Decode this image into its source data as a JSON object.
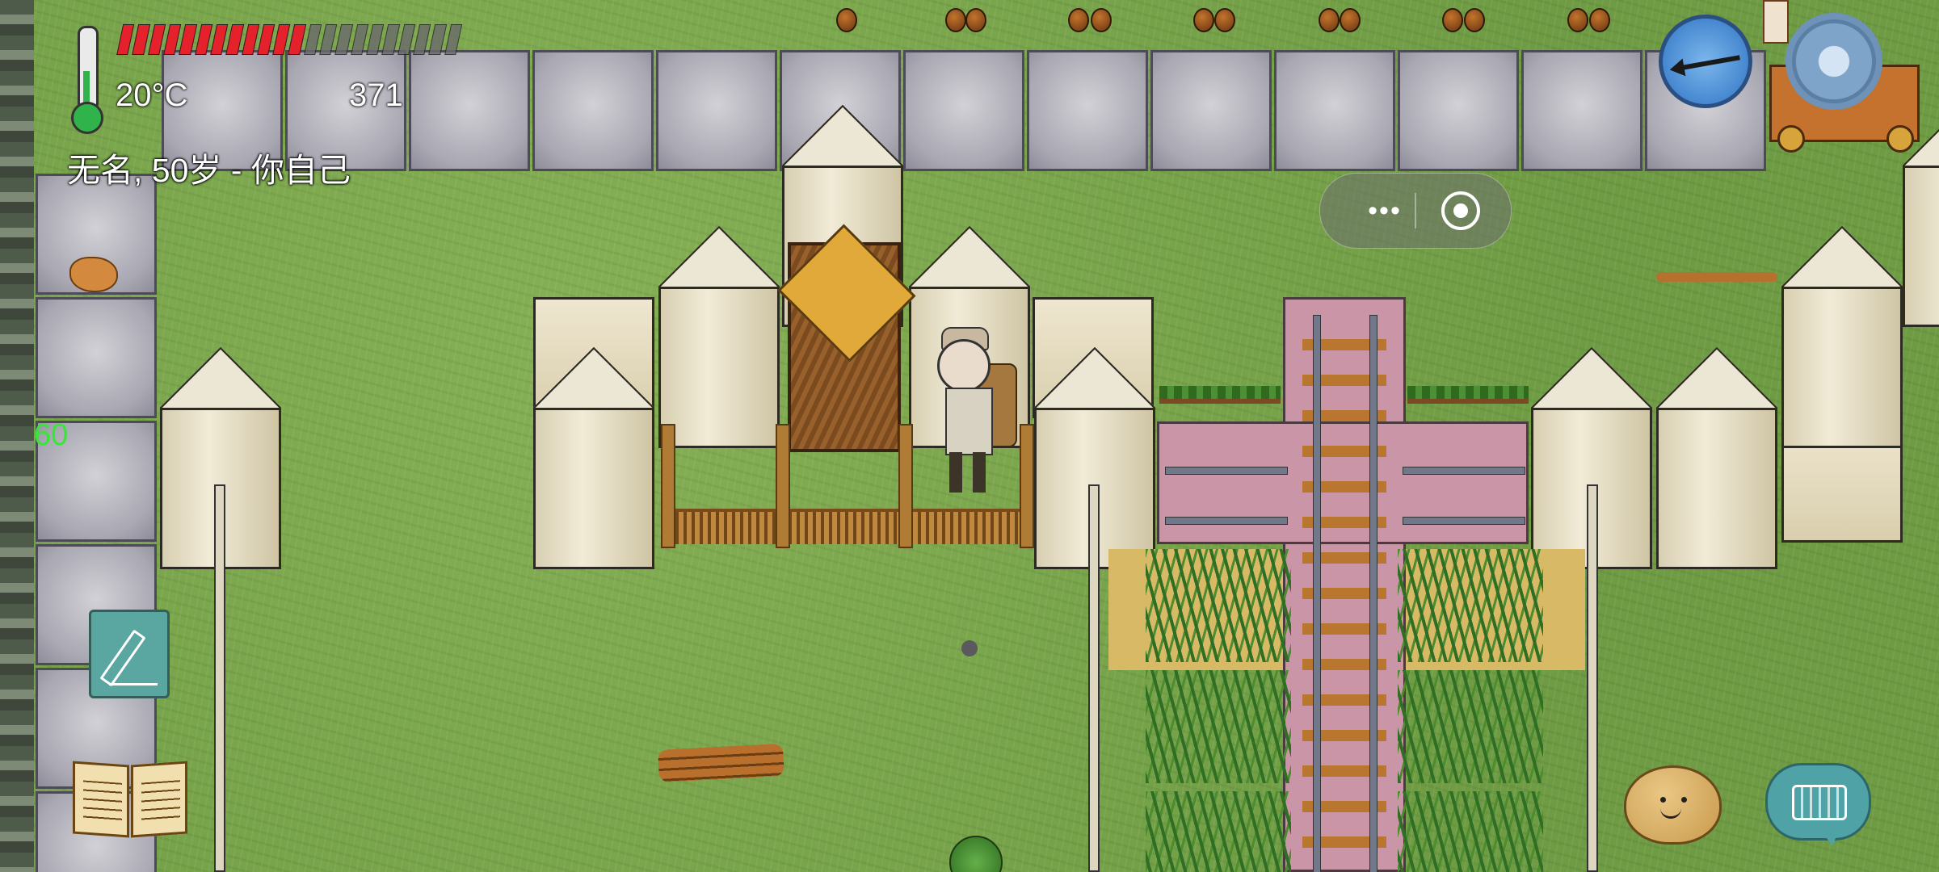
{
  "hud": {
    "temperature": "20°C",
    "counter": "371",
    "character_line": "无名, 50岁 - 你自己",
    "fps": "60",
    "food": {
      "filled_pips": 12,
      "total_pips": 22
    }
  },
  "colors": {
    "food_full": "#e5212b",
    "food_empty": "#6b6b6b",
    "thermometer": "#2fb34a",
    "fps_text": "#37e637",
    "grass": "#6f9a45"
  },
  "icons": {
    "thermometer": "thermometer-icon",
    "compass": "compass-icon",
    "settings": "gear-icon",
    "mini_program_menu": "more-dots-icon",
    "mini_program_close": "target-icon",
    "note": "pencil-icon",
    "recipe_book": "book-icon",
    "emote": "emote-face-icon",
    "keyboard": "keyboard-icon"
  }
}
